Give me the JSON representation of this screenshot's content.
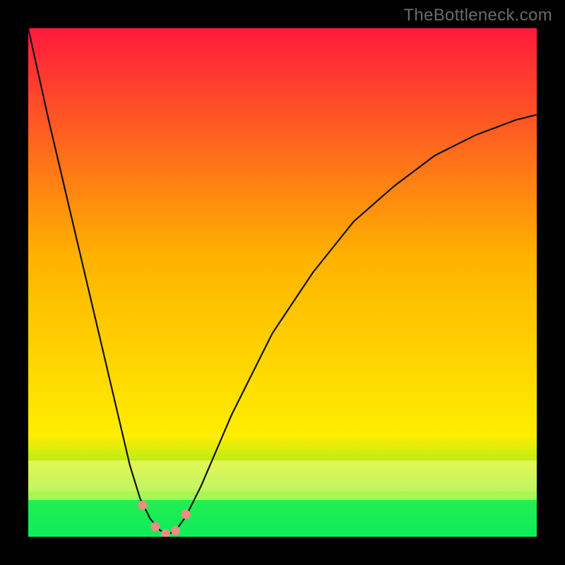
{
  "watermark": "TheBottleneck.com",
  "colors": {
    "gradient_top": "#ff1a3d",
    "gradient_mid": "#ffb300",
    "gradient_low": "#ffee00",
    "gradient_bot": "#00e65a",
    "marker": "#f28b82",
    "curve": "#111111"
  },
  "chart_data": {
    "type": "line",
    "title": "",
    "xlabel": "",
    "ylabel": "",
    "xlim": [
      0,
      1
    ],
    "ylim": [
      0,
      1
    ],
    "note": "x is normalized horizontal position across the plot; y is normalized plotted height (0 at bottom, 1 at top). Values estimated from pixels.",
    "x": [
      0.0,
      0.04,
      0.08,
      0.12,
      0.16,
      0.2,
      0.22,
      0.24,
      0.26,
      0.275,
      0.29,
      0.31,
      0.34,
      0.4,
      0.48,
      0.56,
      0.64,
      0.72,
      0.8,
      0.88,
      0.96,
      1.0
    ],
    "values": [
      1.0,
      0.82,
      0.65,
      0.48,
      0.31,
      0.14,
      0.075,
      0.035,
      0.012,
      0.005,
      0.012,
      0.04,
      0.1,
      0.24,
      0.4,
      0.52,
      0.62,
      0.69,
      0.75,
      0.79,
      0.82,
      0.83
    ],
    "minimum_x": 0.275,
    "markers_x": [
      0.225,
      0.25,
      0.27,
      0.29,
      0.31
    ],
    "markers_y": [
      0.062,
      0.02,
      0.006,
      0.012,
      0.044
    ]
  }
}
